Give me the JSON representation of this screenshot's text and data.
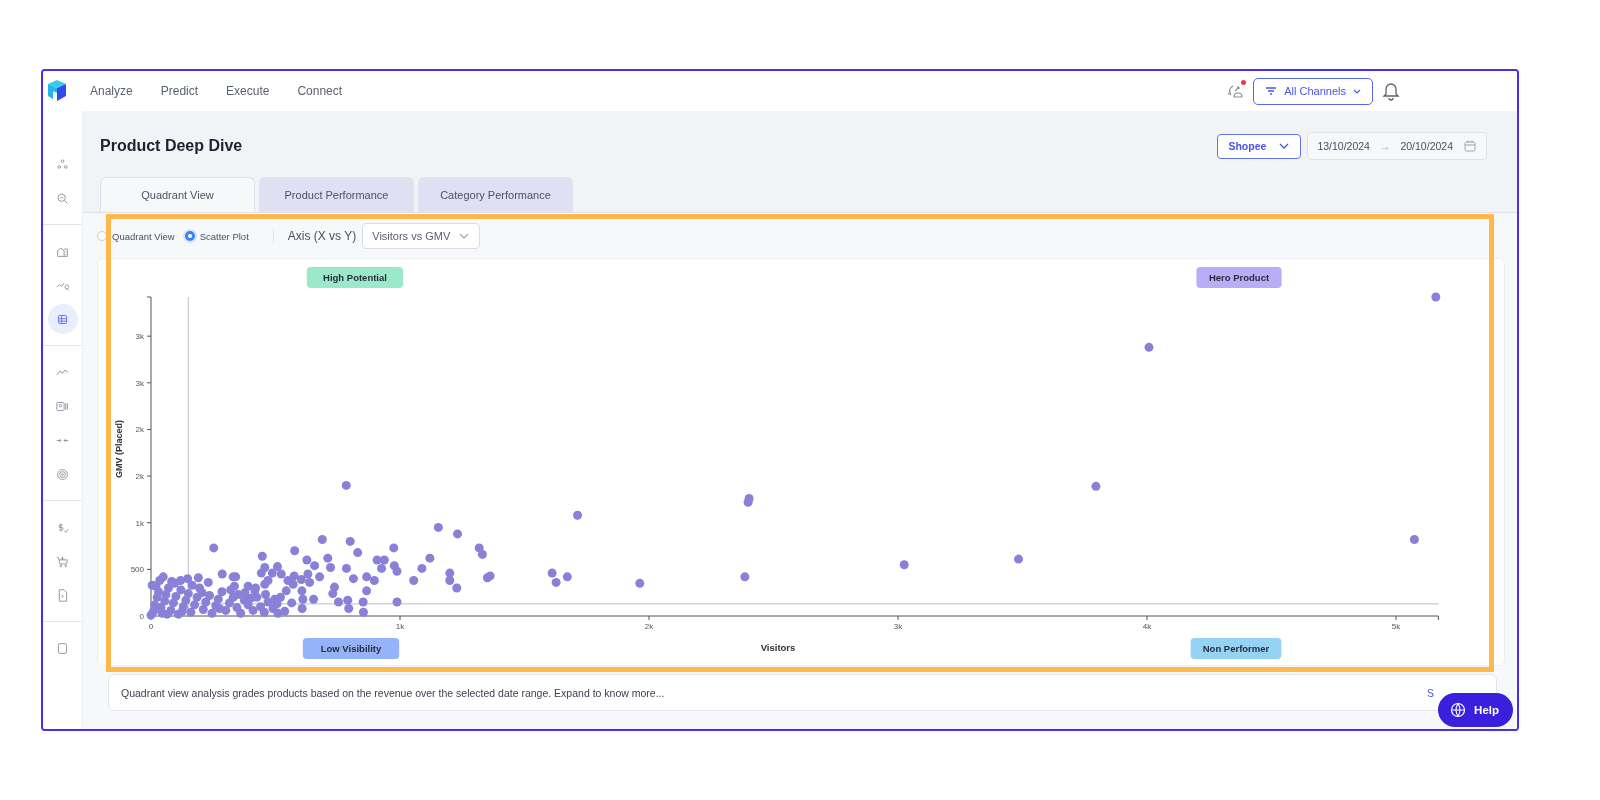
{
  "nav": [
    "Analyze",
    "Predict",
    "Execute",
    "Connect"
  ],
  "top_actions": {
    "sync_alert": true,
    "channel_filter": "All Channels"
  },
  "sidebar": {
    "groups": [
      [
        {
          "selected": false
        },
        {
          "selected": false
        }
      ],
      [
        {
          "selected": false
        },
        {
          "selected": false
        },
        {
          "selected": true
        }
      ],
      [
        {
          "selected": false
        },
        {
          "selected": false
        },
        {
          "selected": false
        },
        {
          "selected": false
        }
      ],
      [
        {
          "selected": false
        },
        {
          "selected": false
        },
        {
          "selected": false
        }
      ],
      [
        {
          "selected": false
        }
      ]
    ]
  },
  "page_title": "Product Deep Dive",
  "marketplace": "Shopee",
  "date_range": {
    "start": "13/10/2024",
    "separator": "→",
    "end": "20/10/2024"
  },
  "tabs": [
    {
      "label": "Quadrant View",
      "selected": true
    },
    {
      "label": "Product Performance",
      "selected": false
    },
    {
      "label": "Category Performance",
      "selected": false
    }
  ],
  "view_options": [
    {
      "label": "Quadrant View",
      "selected": false
    },
    {
      "label": "Scatter Plot",
      "selected": true
    }
  ],
  "axis": {
    "label": "Axis (X vs Y)",
    "value": "Visitors vs GMV"
  },
  "chart_panel": {
    "highlighted": true,
    "quadrant_labels": [
      {
        "label": "High Potential",
        "color": "#9ce8cb"
      },
      {
        "label": "Hero Product",
        "color": "#b9adf7"
      },
      {
        "label": "Low Visibility",
        "color": "#94b3f8"
      },
      {
        "label": "Non Performer",
        "color": "#95d3f4"
      }
    ],
    "chart_data": {
      "type": "scatter",
      "xlabel": "Visitors",
      "ylabel": "GMV (Placed)",
      "x": [
        5160,
        4008,
        3795,
        5074,
        3484,
        3025,
        2402,
        2398,
        2385,
        1963,
        1713,
        1672,
        1627,
        1611,
        1362,
        1351,
        1331,
        1318,
        1231,
        1154,
        1228,
        1200,
        1200,
        1120,
        1088,
        1055,
        988,
        977,
        988,
        975,
        937,
        926,
        908,
        897,
        866,
        866,
        853,
        852,
        830,
        813,
        800,
        794,
        790,
        785,
        784,
        753,
        737,
        730,
        721,
        710,
        688,
        677,
        657,
        653,
        637,
        630,
        626,
        610,
        607,
        606,
        604,
        577,
        575,
        571,
        565,
        550,
        543,
        537,
        523,
        508,
        506,
        497,
        487,
        470,
        457,
        457,
        447,
        443,
        417,
        390,
        377,
        340,
        335,
        330,
        286,
        252,
        190,
        147,
        119,
        83,
        49,
        20,
        10,
        15,
        25,
        30,
        40,
        45,
        55,
        60,
        70,
        80,
        90,
        100,
        110,
        120,
        130,
        140,
        150,
        160,
        175,
        185,
        195,
        210,
        220,
        235,
        245,
        260,
        270,
        285,
        300,
        315,
        330,
        345,
        360,
        375,
        390,
        410,
        425,
        440,
        455,
        470,
        490,
        510,
        5,
        35,
        65,
        95,
        125,
        165,
        205,
        230,
        275,
        320,
        350,
        400,
        420,
        460,
        520,
        0
      ],
      "series": [
        {
          "color": "#8a80d8",
          "values": [
            3420,
            2880,
            1390,
            820,
            610,
            550,
            1260,
            1220,
            420,
            350,
            1080,
            420,
            360,
            460,
            430,
            410,
            660,
            730,
            880,
            950,
            300,
            460,
            380,
            620,
            510,
            380,
            480,
            540,
            150,
            730,
            600,
            510,
            600,
            380,
            420,
            270,
            40,
            150,
            680,
            400,
            800,
            80,
            170,
            510,
            1400,
            150,
            310,
            240,
            520,
            620,
            820,
            420,
            540,
            180,
            360,
            450,
            600,
            180,
            80,
            270,
            390,
            700,
            430,
            340,
            140,
            380,
            270,
            50,
            450,
            530,
            130,
            180,
            460,
            380,
            520,
            340,
            640,
            460,
            270,
            320,
            250,
            420,
            320,
            420,
            450,
            730,
            410,
            400,
            380,
            370,
            420,
            320,
            50,
            120,
            200,
            260,
            90,
            30,
            160,
            230,
            300,
            60,
            140,
            210,
            20,
            280,
            100,
            170,
            240,
            40,
            120,
            200,
            300,
            70,
            150,
            220,
            30,
            110,
            180,
            260,
            60,
            140,
            200,
            90,
            30,
            170,
            120,
            60,
            200,
            100,
            40,
            150,
            80,
            30,
            330,
            380,
            20,
            350,
            50,
            330,
            250,
            360,
            80,
            280,
            230,
            190,
            300,
            230,
            200,
            10
          ]
        }
      ],
      "xlim": [
        0,
        5170
      ],
      "ylim": [
        0,
        3420
      ],
      "xticks": [
        {
          "value": 0,
          "label": "0"
        },
        {
          "value": 1000,
          "label": "1k"
        },
        {
          "value": 2000,
          "label": "2k"
        },
        {
          "value": 3000,
          "label": "3k"
        },
        {
          "value": 4000,
          "label": "4k"
        },
        {
          "value": 5000,
          "label": "5k"
        }
      ],
      "yticks": [
        {
          "value": 0,
          "label": "0"
        },
        {
          "value": 500,
          "label": "500"
        },
        {
          "value": 1000,
          "label": "1k"
        },
        {
          "value": 1500,
          "label": "2k"
        },
        {
          "value": 2000,
          "label": "2k"
        },
        {
          "value": 2500,
          "label": "3k"
        },
        {
          "value": 3000,
          "label": "3k"
        }
      ],
      "ref_lines": [
        {
          "axis": "x",
          "value": 150
        },
        {
          "axis": "y",
          "value": 130
        }
      ]
    }
  },
  "info": {
    "text": "Quadrant view analysis grades products based on the revenue over the selected date range. Expand to know more...",
    "link": "S"
  },
  "help_button": "Help"
}
